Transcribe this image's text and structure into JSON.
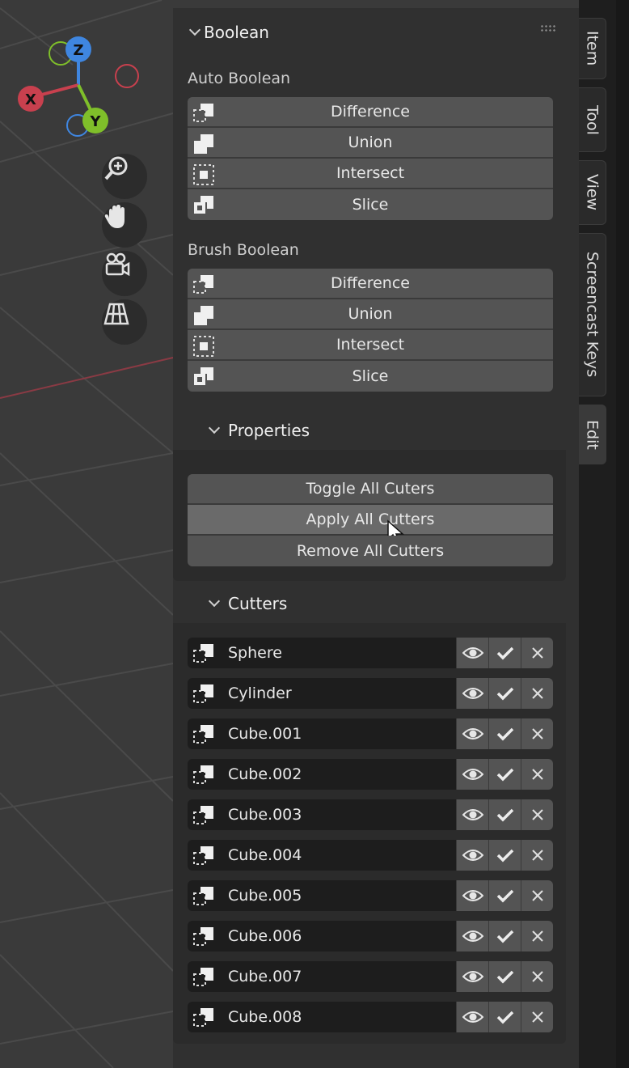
{
  "gizmo": {
    "z": "Z",
    "x": "X",
    "y": "Y"
  },
  "nav_tools": [
    "zoom-icon",
    "hand-icon",
    "camera-icon",
    "grid-icon"
  ],
  "panel": {
    "title": "Boolean",
    "auto_boolean": {
      "label": "Auto Boolean",
      "buttons": [
        "Difference",
        "Union",
        "Intersect",
        "Slice"
      ]
    },
    "brush_boolean": {
      "label": "Brush Boolean",
      "buttons": [
        "Difference",
        "Union",
        "Intersect",
        "Slice"
      ]
    },
    "properties": {
      "title": "Properties",
      "buttons": [
        "Toggle All Cuters",
        "Apply All Cutters",
        "Remove All Cutters"
      ]
    },
    "cutters": {
      "title": "Cutters",
      "items": [
        "Sphere",
        "Cylinder",
        "Cube.001",
        "Cube.002",
        "Cube.003",
        "Cube.004",
        "Cube.005",
        "Cube.006",
        "Cube.007",
        "Cube.008"
      ]
    }
  },
  "tabs": [
    "Item",
    "Tool",
    "View",
    "Screencast Keys",
    "Edit"
  ],
  "colors": {
    "x_axis": "#c8404e",
    "y_axis": "#7fbf2a",
    "z_axis": "#3f86e0",
    "accent": "#4772b3"
  }
}
